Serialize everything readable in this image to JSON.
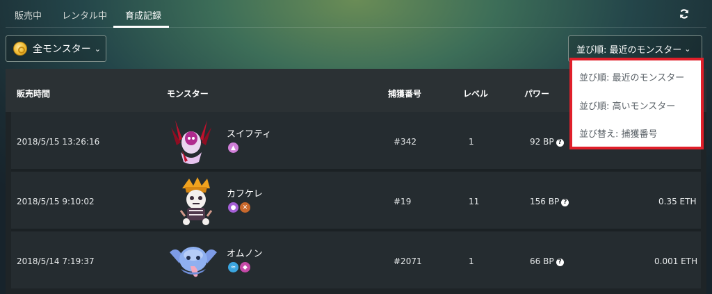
{
  "tabs": [
    {
      "label": "販売中"
    },
    {
      "label": "レンタル中"
    },
    {
      "label": "育成記録"
    }
  ],
  "filter": {
    "label": "全モンスター",
    "icon": "gold-coin-icon"
  },
  "sort": {
    "label": "並び順: 最近のモンスター",
    "options": [
      "並び順: 最近のモンスター",
      "並び順: 高いモンスター",
      "並び替え: 捕獲番号"
    ]
  },
  "table": {
    "headers": {
      "time": "販売時間",
      "monster": "モンスター",
      "number": "捕獲番号",
      "level": "レベル",
      "power": "パワー"
    },
    "rows": [
      {
        "time": "2018/5/15 13:26:16",
        "monster": "スイフティ",
        "number": "#342",
        "level": "1",
        "power": "92 BP",
        "price": ""
      },
      {
        "time": "2018/5/15 9:10:02",
        "monster": "カフケレ",
        "number": "#19",
        "level": "11",
        "power": "156 BP",
        "price": "0.35 ETH"
      },
      {
        "time": "2018/5/14 7:19:37",
        "monster": "オムノン",
        "number": "#2071",
        "level": "1",
        "power": "66 BP",
        "price": "0.001 ETH"
      }
    ]
  },
  "colors": {
    "highlight": "#e01f2a",
    "row": "#252c30",
    "header": "#2b3134"
  }
}
